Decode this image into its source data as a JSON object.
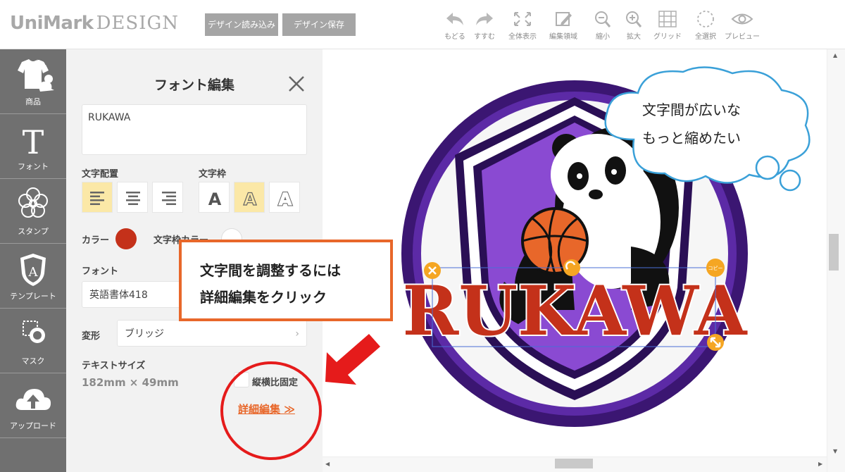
{
  "header": {
    "logo_bold": "UniMark",
    "logo_serif": "DESIGN",
    "load_button": "デザイン読み込み",
    "save_button": "デザイン保存",
    "tools": [
      {
        "icon": "undo-icon",
        "label": "もどる"
      },
      {
        "icon": "redo-icon",
        "label": "すすむ"
      },
      {
        "icon": "fit-screen-icon",
        "label": "全体表示"
      },
      {
        "icon": "edit-area-icon",
        "label": "編集領域"
      },
      {
        "icon": "zoom-out-icon",
        "label": "縮小"
      },
      {
        "icon": "zoom-in-icon",
        "label": "拡大"
      },
      {
        "icon": "grid-icon",
        "label": "グリッド"
      },
      {
        "icon": "select-all-icon",
        "label": "全選択"
      },
      {
        "icon": "preview-icon",
        "label": "プレビュー"
      }
    ]
  },
  "leftnav": {
    "items": [
      {
        "icon": "tshirt-icon",
        "label": "商品"
      },
      {
        "icon": "font-icon",
        "label": "フォント"
      },
      {
        "icon": "stamp-icon",
        "label": "スタンプ"
      },
      {
        "icon": "template-icon",
        "label": "テンプレート"
      },
      {
        "icon": "mask-icon",
        "label": "マスク"
      },
      {
        "icon": "upload-icon",
        "label": "アップロード"
      }
    ]
  },
  "panel": {
    "title": "フォント編集",
    "text_value": "RUKAWA",
    "align_label": "文字配置",
    "frame_label": "文字枠",
    "frame_letter": "A",
    "color_label": "カラー",
    "color_value": "#c4311a",
    "frame_color_label": "文字枠カラー",
    "frame_color_value": "#ffffff",
    "font_label": "フォント",
    "font_value": "英語書体418",
    "transform_label": "変形",
    "transform_value": "ブリッジ",
    "size_label": "テキストサイズ",
    "size_value": "182mm × 49mm",
    "lock_label": "縦横比固定",
    "detail_link": "詳細編集 ≫"
  },
  "canvas": {
    "patch_text": "RUKAWA",
    "handle_copy": "コピー",
    "colors": {
      "border": "#4a1e86",
      "shield_purple": "#8a4ad2",
      "text_red": "#c4311a",
      "handle": "#f5a623",
      "ball": "#e8672a"
    }
  },
  "annotations": {
    "callout_line1": "文字間を調整するには",
    "callout_line2": "詳細編集をクリック",
    "thought_line1": "文字間が広いな",
    "thought_line2": "もっと縮めたい"
  }
}
